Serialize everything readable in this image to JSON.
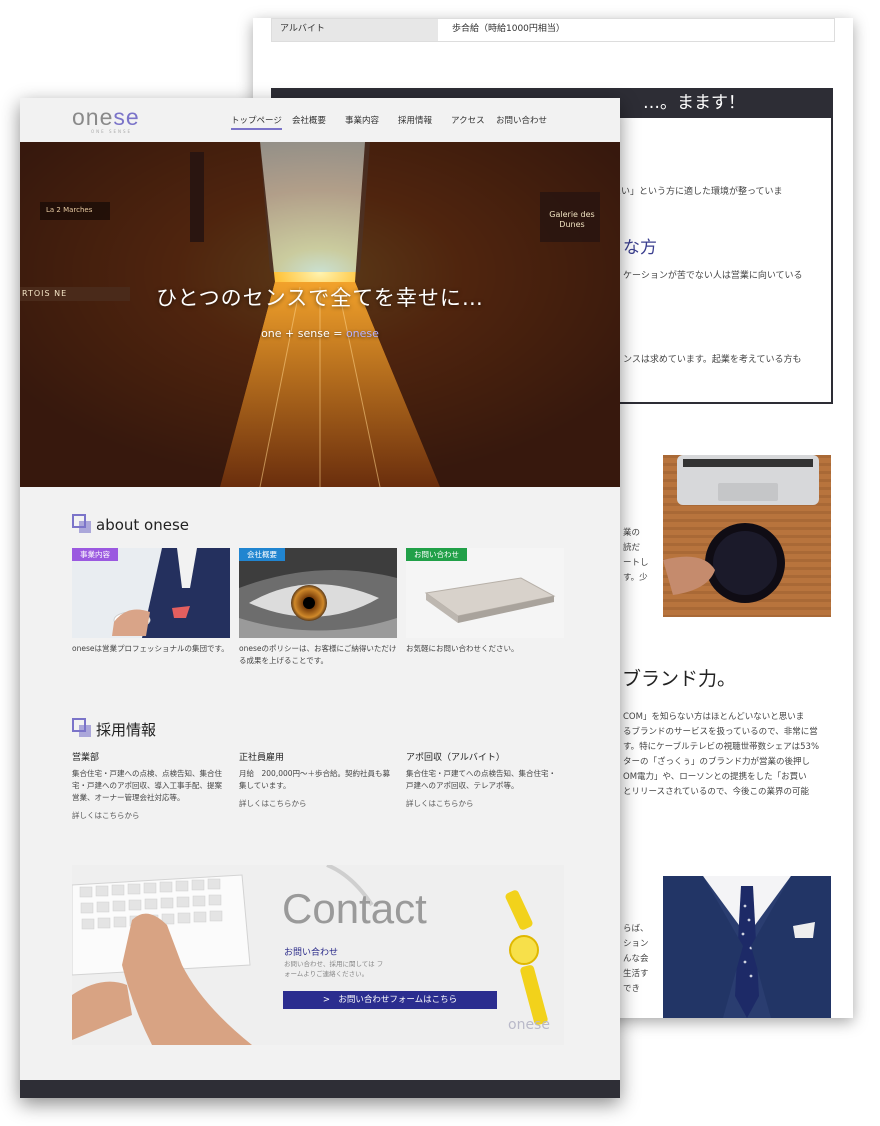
{
  "back_page": {
    "salary_row": {
      "key": "アルバイト",
      "value": "歩合給（時給1000円相当）"
    },
    "dark_heading": "…。まます！",
    "frag1": "ぎたい」という方に適した環境が整っていま",
    "heading_frag": "な方",
    "frag2": "ケーションが苦でない人は営業に向いている",
    "frag3": "ンスは求めています。起業を考えている方も",
    "left_frags": [
      "業の",
      "読だ",
      "ートし",
      "す。少"
    ],
    "big_heading": "とブランド力。",
    "para_lines": [
      "COM」を知らない方はほとんどいないと思いま",
      "るブランドのサービスを扱っているので、非常に営",
      "す。特にケーブルテレビの視聴世帯数シェアは53%",
      "ターの「ざっくぅ」のブランド力が営業の後押し",
      "OM電力」や、ローソンとの提携をした「お買い",
      "とリリースされているので、今後この業界の可能"
    ],
    "frags4": [
      "らば、",
      "ション",
      "んな会",
      "生活す",
      "でき"
    ]
  },
  "header": {
    "logo_a": "one",
    "logo_b": "se",
    "logo_sub": "ONE SENSE",
    "nav": [
      "トップページ",
      "会社概要",
      "事業内容",
      "採用情報",
      "アクセス",
      "お問い合わせ"
    ]
  },
  "hero": {
    "title": "ひとつのセンスで全てを幸せに…",
    "sub_a": "one + sense = ",
    "sub_b": "onese",
    "signs": [
      "Galerie des Dunes",
      "La 2 Marches",
      "RTOIS NE"
    ]
  },
  "about": {
    "title": "about onese",
    "cards": [
      {
        "badge": "事業内容",
        "badge_color": "#9b59e0",
        "text": "oneseは営業プロフェッショナルの集団です。"
      },
      {
        "badge": "会社概要",
        "badge_color": "#2185d0",
        "text": "oneseのポリシーは、お客様にご納得いただける成果を上げることです。"
      },
      {
        "badge": "お問い合わせ",
        "badge_color": "#21a048",
        "text": "お気軽にお問い合わせください。"
      }
    ]
  },
  "recruit": {
    "title": "採用情報",
    "cols": [
      {
        "head": "営業部",
        "body": "集合住宅・戸建への点検、点検告知、集合住宅・戸建へのアポ回収、導入工事手配、提案営業、オーナー管理会社対応等。",
        "link": "詳しくはこちらから"
      },
      {
        "head": "正社員雇用",
        "body": "月給　200,000円〜＋歩合給。契約社員も募集しています。",
        "link": "詳しくはこちらから"
      },
      {
        "head": "アポ回収（アルバイト）",
        "body": "集合住宅・戸建てへの点検告知、集合住宅・戸建へのアポ回収、テレアポ等。",
        "link": "詳しくはこちらから"
      }
    ]
  },
  "contact": {
    "big": "Contact",
    "label": "お問い合わせ",
    "small": "お問い合わせ、採用に関しては フォームよりご連絡ください。",
    "button": ">　お問い合わせフォームはこちら",
    "watermark": "onese"
  },
  "colors": {
    "accent": "#7b74c9",
    "dark": "#2e2e36",
    "button": "#2b2d8f"
  }
}
